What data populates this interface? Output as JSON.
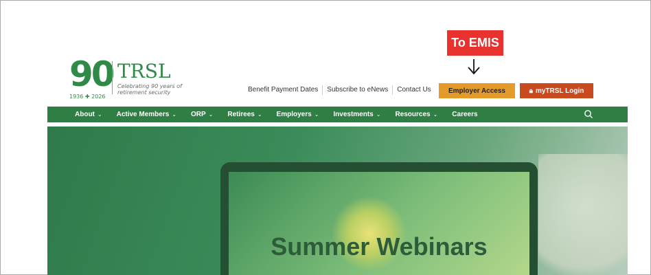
{
  "logo": {
    "number": "90",
    "years": "1936 ✚ 2026",
    "name": "TRSL",
    "tagline": "Celebrating 90 years of retirement security"
  },
  "utility_nav": [
    {
      "label": "Benefit Payment Dates"
    },
    {
      "label": "Subscribe to eNews"
    },
    {
      "label": "Contact Us"
    }
  ],
  "buttons": {
    "employer_access": "Employer Access",
    "mytrsl_login": "myTRSL Login"
  },
  "main_nav": [
    {
      "label": "About",
      "dropdown": true
    },
    {
      "label": "Active Members",
      "dropdown": true
    },
    {
      "label": "ORP",
      "dropdown": true
    },
    {
      "label": "Retirees",
      "dropdown": true
    },
    {
      "label": "Employers",
      "dropdown": true
    },
    {
      "label": "Investments",
      "dropdown": true
    },
    {
      "label": "Resources",
      "dropdown": true
    },
    {
      "label": "Careers",
      "dropdown": false
    }
  ],
  "hero": {
    "title": "Summer Webinars"
  },
  "callout": {
    "label": "To EMIS",
    "arrow": "↓"
  },
  "icons": {
    "search": "search-icon",
    "lock": "lock-icon",
    "chevron": "chevron-down-icon"
  },
  "colors": {
    "brand_green": "#2f7e44",
    "employer_orange": "#e59a2c",
    "login_red": "#c94a1e",
    "callout_red": "#e8322f"
  }
}
